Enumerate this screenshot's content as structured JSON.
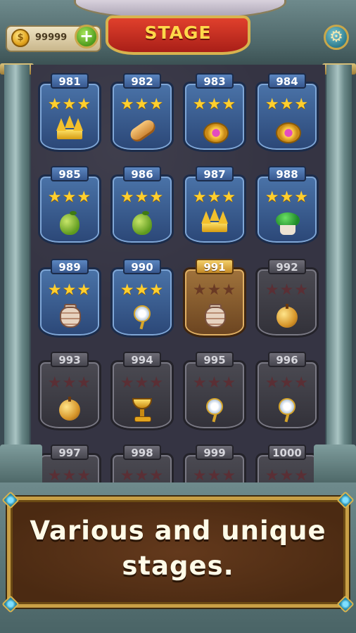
{
  "header": {
    "coins": "99999",
    "stage_title": "STAGE"
  },
  "icons": {
    "coin": "coin-icon",
    "plus": "plus-icon",
    "settings": "gear-icon",
    "star": "star-icon"
  },
  "colors": {
    "completed_tile": "#3a5e92",
    "current_tile": "#8a5a2c",
    "locked_tile": "#403f47",
    "star_gold": "#ffcf2e",
    "stage_banner": "#c42c20"
  },
  "stages": [
    {
      "number": "981",
      "state": "completed",
      "stars": 3,
      "item": "crown"
    },
    {
      "number": "982",
      "state": "completed",
      "stars": 3,
      "item": "bread"
    },
    {
      "number": "983",
      "state": "completed",
      "stars": 3,
      "item": "gem-ring"
    },
    {
      "number": "984",
      "state": "completed",
      "stars": 3,
      "item": "gem-ring"
    },
    {
      "number": "985",
      "state": "completed",
      "stars": 3,
      "item": "pear"
    },
    {
      "number": "986",
      "state": "completed",
      "stars": 3,
      "item": "pear"
    },
    {
      "number": "987",
      "state": "completed",
      "stars": 3,
      "item": "crown"
    },
    {
      "number": "988",
      "state": "completed",
      "stars": 3,
      "item": "potted-plant"
    },
    {
      "number": "989",
      "state": "completed",
      "stars": 3,
      "item": "vase"
    },
    {
      "number": "990",
      "state": "completed",
      "stars": 3,
      "item": "flower"
    },
    {
      "number": "991",
      "state": "current",
      "stars": 0,
      "item": "vase"
    },
    {
      "number": "992",
      "state": "locked",
      "stars": 0,
      "item": "apple"
    },
    {
      "number": "993",
      "state": "locked",
      "stars": 0,
      "item": "apple"
    },
    {
      "number": "994",
      "state": "locked",
      "stars": 0,
      "item": "chalice"
    },
    {
      "number": "995",
      "state": "locked",
      "stars": 0,
      "item": "flower"
    },
    {
      "number": "996",
      "state": "locked",
      "stars": 0,
      "item": "flower"
    },
    {
      "number": "997",
      "state": "locked",
      "stars": 0,
      "item": ""
    },
    {
      "number": "998",
      "state": "locked",
      "stars": 0,
      "item": ""
    },
    {
      "number": "999",
      "state": "locked",
      "stars": 0,
      "item": ""
    },
    {
      "number": "1000",
      "state": "locked",
      "stars": 0,
      "item": ""
    }
  ],
  "caption": {
    "line1": "Various and unique",
    "line2": "stages."
  }
}
